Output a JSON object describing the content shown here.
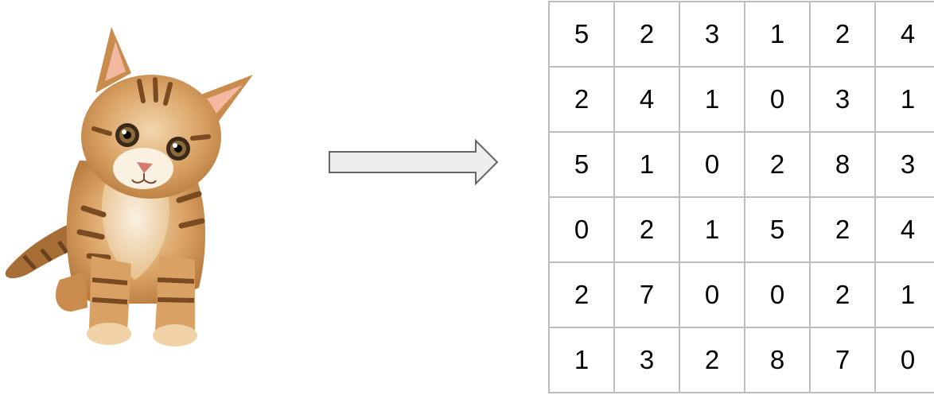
{
  "image": {
    "subject": "kitten",
    "icon": "kitten-photo"
  },
  "arrow": {
    "icon": "right-arrow-icon",
    "fill": "#eeeeee",
    "stroke": "#666666"
  },
  "matrix": {
    "rows": [
      [
        "5",
        "2",
        "3",
        "1",
        "2",
        "4"
      ],
      [
        "2",
        "4",
        "1",
        "0",
        "3",
        "1"
      ],
      [
        "5",
        "1",
        "0",
        "2",
        "8",
        "3"
      ],
      [
        "0",
        "2",
        "1",
        "5",
        "2",
        "4"
      ],
      [
        "2",
        "7",
        "0",
        "0",
        "2",
        "1"
      ],
      [
        "1",
        "3",
        "2",
        "8",
        "7",
        "0"
      ]
    ],
    "border_color": "#bdbdbd"
  }
}
